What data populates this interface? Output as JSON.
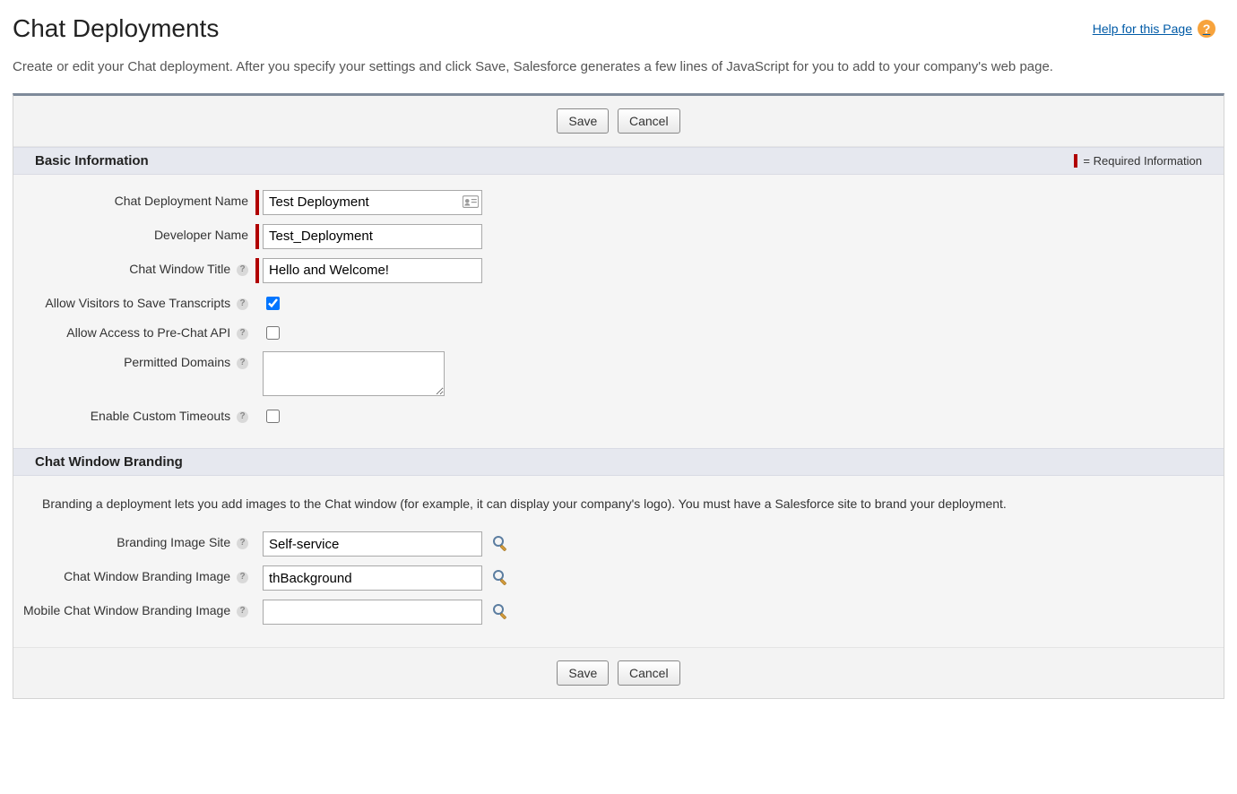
{
  "pageTitle": "Chat Deployments",
  "helpLinkLabel": "Help for this Page",
  "intro": "Create or edit your Chat deployment. After you specify your settings and click Save, Salesforce generates a few lines of JavaScript for you to add to your company's web page.",
  "buttons": {
    "save": "Save",
    "cancel": "Cancel"
  },
  "requiredInfoText": "= Required Information",
  "sections": {
    "basic": {
      "title": "Basic Information",
      "fields": {
        "deploymentName": {
          "label": "Chat Deployment Name",
          "value": "Test Deployment"
        },
        "developerName": {
          "label": "Developer Name",
          "value": "Test_Deployment"
        },
        "windowTitle": {
          "label": "Chat Window Title",
          "value": "Hello and Welcome!"
        },
        "allowSaveTranscripts": {
          "label": "Allow Visitors to Save Transcripts",
          "checked": true
        },
        "allowPreChatApi": {
          "label": "Allow Access to Pre-Chat API",
          "checked": false
        },
        "permittedDomains": {
          "label": "Permitted Domains",
          "value": ""
        },
        "enableCustomTimeouts": {
          "label": "Enable Custom Timeouts",
          "checked": false
        }
      }
    },
    "branding": {
      "title": "Chat Window Branding",
      "description": "Branding a deployment lets you add images to the Chat window (for example, it can display your company's logo). You must have a Salesforce site to brand your deployment.",
      "fields": {
        "brandingSite": {
          "label": "Branding Image Site",
          "value": "Self-service"
        },
        "brandingImage": {
          "label": "Chat Window Branding Image",
          "value": "thBackground"
        },
        "mobileBrandingImage": {
          "label": "Mobile Chat Window Branding Image",
          "value": ""
        }
      }
    }
  }
}
